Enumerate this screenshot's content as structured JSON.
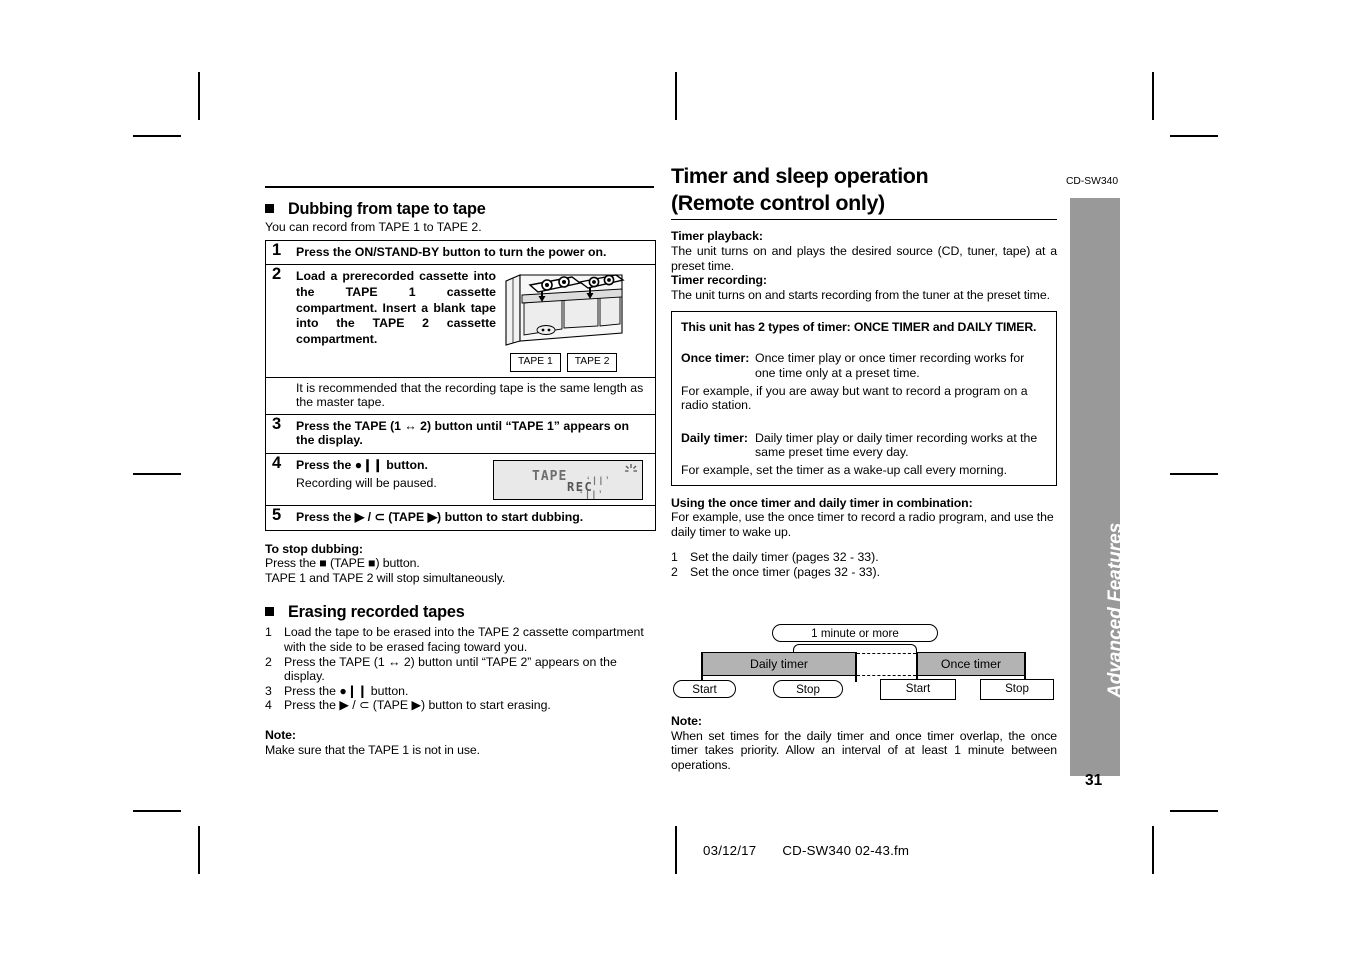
{
  "meta": {
    "model_code": "CD-SW340",
    "section_tab": "Advanced Features",
    "page_number": "31",
    "footer_date": "03/12/17",
    "footer_file": "CD-SW340 02-43.fm"
  },
  "left": {
    "dubbing": {
      "heading": "Dubbing from tape to tape",
      "intro": "You can record from TAPE 1 to TAPE 2.",
      "steps": [
        {
          "num": "1",
          "text": "Press the ON/STAND-BY button to turn the power on."
        },
        {
          "num": "2",
          "text": "Load a prerecorded cassette into the TAPE 1 cassette compartment. Insert a blank tape into the TAPE 2 cassette compartment."
        },
        {
          "num": "3",
          "text": "Press the TAPE (1 ↔ 2) button until “TAPE 1” appears on the display."
        },
        {
          "num": "4",
          "text": "Press the ●❙❙ button.",
          "sub": "Recording will be paused."
        },
        {
          "num": "5",
          "text": "Press the ▶ / ⊂ (TAPE ▶) button to start dubbing."
        }
      ],
      "tape_labels": [
        "TAPE 1",
        "TAPE 2"
      ],
      "recommendation": "It is recommended that the recording tape is the same length as the master tape.",
      "display": {
        "line1": "TAPE",
        "line2": "REC"
      }
    },
    "stop_dubbing": {
      "heading": "To stop dubbing:",
      "lines": [
        "Press the ■ (TAPE ■) button.",
        "TAPE 1 and TAPE 2 will stop simultaneously."
      ]
    },
    "erasing": {
      "heading": "Erasing recorded tapes",
      "steps": [
        {
          "num": "1",
          "text": "Load the tape to be erased into the TAPE 2 cassette compartment with the side to be erased facing toward you."
        },
        {
          "num": "2",
          "text": "Press the TAPE (1 ↔ 2) button until “TAPE 2” appears on the display."
        },
        {
          "num": "3",
          "text": "Press the ●❙❙ button."
        },
        {
          "num": "4",
          "text": "Press the ▶ / ⊂ (TAPE ▶) button to start erasing."
        }
      ]
    },
    "note": {
      "heading": "Note:",
      "text": "Make sure that the TAPE 1 is not in use."
    }
  },
  "right": {
    "title": {
      "line1": "Timer and sleep operation",
      "line2": "(Remote control only)"
    },
    "timer_playback": {
      "heading": "Timer playback:",
      "text": "The unit turns on and plays the desired source (CD, tuner, tape) at a preset time."
    },
    "timer_recording": {
      "heading": "Timer recording:",
      "text": "The unit turns on and starts recording from the tuner at the preset time."
    },
    "infobox": {
      "heading": "This unit has 2 types of timer: ONCE TIMER and DAILY TIMER.",
      "once": {
        "label": "Once timer:",
        "desc": "Once timer play or once timer recording works for one time only at a preset time.",
        "example": "For example, if you are away but want to record a program on a radio station."
      },
      "daily": {
        "label": "Daily timer:",
        "desc": "Daily timer play or daily timer recording works at the same preset time every day.",
        "example": "For example, set the timer as a wake-up call every morning."
      }
    },
    "combination": {
      "heading": "Using the once timer and daily timer in combination:",
      "text": "For example, use the once timer to record a radio program, and use the daily timer to wake up.",
      "steps": [
        {
          "num": "1",
          "text": "Set the daily timer (pages 32 - 33)."
        },
        {
          "num": "2",
          "text": "Set the once timer (pages 32 - 33)."
        }
      ]
    },
    "diagram": {
      "interval": "1 minute or more",
      "daily_bar": "Daily timer",
      "once_bar": "Once timer",
      "daily_start": "Start",
      "daily_stop": "Stop",
      "once_start": "Start",
      "once_stop": "Stop"
    },
    "diagram_note": {
      "heading": "Note:",
      "text": "When set times for the daily timer and once timer overlap, the once timer takes priority. Allow an interval of at least 1 minute between operations."
    }
  }
}
